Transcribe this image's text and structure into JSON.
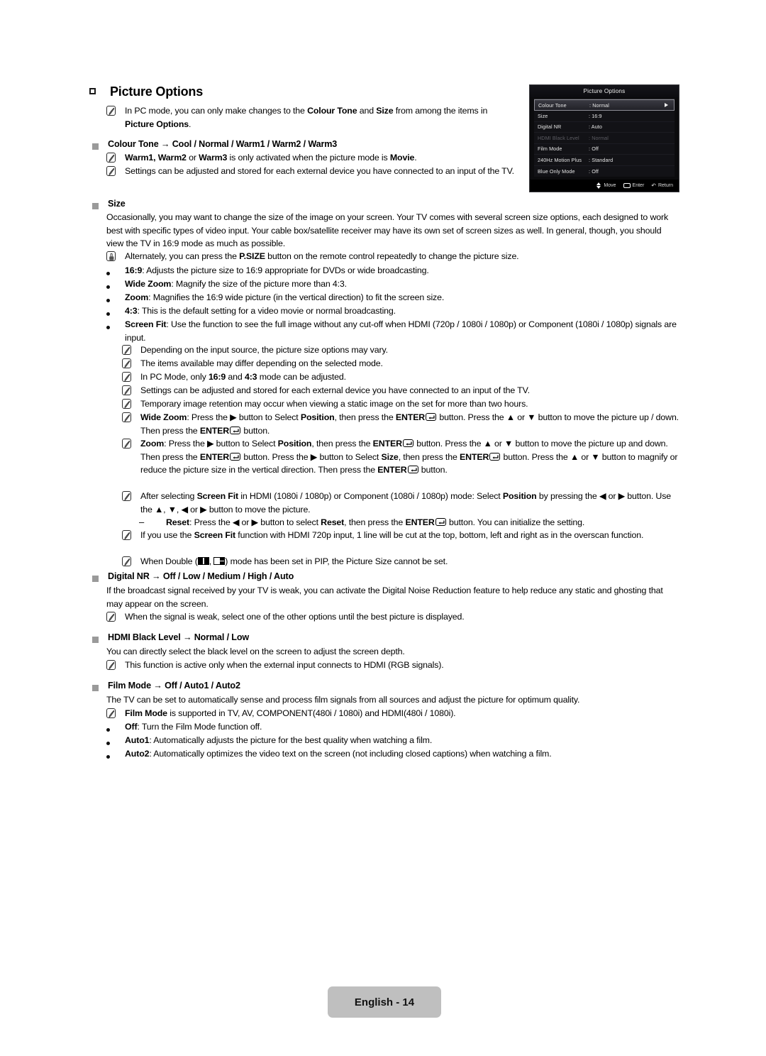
{
  "page": {
    "heading": "Picture Options",
    "footer_label": "English - 14"
  },
  "osd": {
    "title": "Picture Options",
    "rows": [
      {
        "label": "Colour Tone",
        "value": ": Normal",
        "selected": true,
        "disabled": false
      },
      {
        "label": "Size",
        "value": ": 16:9",
        "selected": false,
        "disabled": false
      },
      {
        "label": "Digital NR",
        "value": ": Auto",
        "selected": false,
        "disabled": false
      },
      {
        "label": "HDMI Black Level",
        "value": ": Normal",
        "selected": false,
        "disabled": true
      },
      {
        "label": "Film Mode",
        "value": ": Off",
        "selected": false,
        "disabled": false
      },
      {
        "label": "240Hz Motion Plus",
        "value": ": Standard",
        "selected": false,
        "disabled": false
      },
      {
        "label": "Blue Only Mode",
        "value": ": Off",
        "selected": false,
        "disabled": false
      }
    ],
    "footer": {
      "move": "Move",
      "enter": "Enter",
      "return": "Return"
    }
  },
  "intro_note": {
    "p1": "In PC mode, you can only make changes to the ",
    "b1": "Colour Tone",
    "p2": " and ",
    "b2": "Size",
    "p3": " from among the items in ",
    "b3": "Picture Options",
    "p4": "."
  },
  "colour_tone": {
    "heading_bold": "Colour Tone",
    "heading_rest": " → Cool / Normal / Warm1 / Warm2 / Warm3",
    "note1": {
      "b1": "Warm1, Warm2",
      "t1": " or ",
      "b2": "Warm3",
      "t2": " is only activated when the picture mode is ",
      "b3": "Movie",
      "t3": "."
    },
    "note2": "Settings can be adjusted and stored for each external device you have connected to an input of the TV."
  },
  "size": {
    "heading": "Size",
    "paragraph": "Occasionally, you may want to change the size of the image on your screen. Your TV comes with several screen size options, each designed to work best with specific types of video input. Your cable box/satellite receiver may have its own set of screen sizes as well. In general, though, you should view the TV in 16:9 mode as much as possible.",
    "hand_note": {
      "t1": "Alternately, you can press the ",
      "b1": "P.SIZE",
      "t2": " button on the remote control repeatedly to change the picture size."
    },
    "bullets": [
      {
        "bold": "16:9",
        "rest": ": Adjusts the picture size to 16:9 appropriate for DVDs or wide broadcasting."
      },
      {
        "bold": "Wide Zoom",
        "rest": ": Magnify the size of the picture more than 4:3."
      },
      {
        "bold": "Zoom",
        "rest": ": Magnifies the 16:9 wide picture (in the vertical direction) to fit the screen size."
      },
      {
        "bold": "4:3",
        "rest": ": This is the default setting for a video movie or normal broadcasting."
      },
      {
        "bold": "Screen Fit",
        "rest": ": Use the function to see the full image without any cut-off when HDMI (720p / 1080i / 1080p) or Component (1080i / 1080p) signals are input."
      }
    ],
    "notes": {
      "n1": "Depending on the input source, the picture size options may vary.",
      "n2": "The items available may differ depending on the selected mode.",
      "n3": {
        "t1": "In PC Mode, only ",
        "b1": "16:9",
        "t2": " and ",
        "b2": "4:3",
        "t3": " mode can be adjusted."
      },
      "n4": "Settings can be adjusted and stored for each external device you have connected to an input of the TV.",
      "n5": "Temporary image retention may occur when viewing a static image on the set for more than two hours.",
      "n6": {
        "b1": "Wide Zoom",
        "t1": ": Press the ▶ button to Select ",
        "b2": "Position",
        "t2": ", then press the ",
        "b3": "ENTER",
        "t3": " button. Press the ▲ or ▼ button to move the picture up / down. Then press the ",
        "b4": "ENTER",
        "t4": " button."
      },
      "n7": {
        "b1": "Zoom",
        "t1": ": Press the ▶ button to Select ",
        "b2": "Position",
        "t2": ", then press the ",
        "b3": "ENTER",
        "t3": " button. Press the ▲ or ▼ button to move the picture up and down. Then press the ",
        "b4": "ENTER",
        "t4": " button. Press the ▶ button to Select ",
        "b5": "Size",
        "t5": ", then press the ",
        "b6": "ENTER",
        "t6": " button. Press the ▲ or ▼ button to magnify or reduce the picture size in the vertical direction. Then press the ",
        "b7": "ENTER",
        "t7": " button."
      },
      "n8": {
        "t1": "After selecting ",
        "b1": "Screen Fit",
        "t2": " in HDMI (1080i / 1080p) or Component (1080i / 1080p) mode: Select ",
        "b2": "Position",
        "t3": " by pressing the ◀ or ▶ button. Use the ▲, ▼, ◀ or ▶ button to move the picture."
      },
      "reset": {
        "b1": "Reset",
        "t1": ": Press the ◀ or ▶ button to select ",
        "b2": "Reset",
        "t2": ", then press the ",
        "b3": "ENTER",
        "t3": " button. You can initialize the setting."
      },
      "n9": {
        "t1": "If you use the ",
        "b1": "Screen Fit",
        "t2": " function with HDMI 720p input, 1 line will be cut at the top, bottom, left and right as in the overscan function."
      },
      "n10": {
        "t1": "When Double (",
        "t2": ", ",
        "t3": ") mode has been set in PIP, the Picture Size cannot be set."
      }
    }
  },
  "digital_nr": {
    "heading_bold": "Digital NR",
    "heading_rest": " → Off / Low / Medium / High / Auto",
    "paragraph": "If the broadcast signal received by your TV is weak, you can activate the Digital Noise Reduction feature to help reduce any static and ghosting that may appear on the screen.",
    "note": "When the signal is weak, select one of the other options until the best picture is displayed."
  },
  "hdmi_black_level": {
    "heading_bold": "HDMI Black Level",
    "heading_rest": " → Normal / Low",
    "paragraph": "You can directly select the black level on the screen to adjust the screen depth.",
    "note": "This function is active only when the external input connects to HDMI (RGB signals)."
  },
  "film_mode": {
    "heading_bold": "Film Mode",
    "heading_rest": " → Off / Auto1 / Auto2",
    "paragraph": "The TV can be set to automatically sense and process film signals from all sources and adjust the picture for optimum quality.",
    "note": {
      "b1": "Film Mode",
      "t1": " is supported in TV, AV, COMPONENT(480i / 1080i) and HDMI(480i / 1080i)."
    },
    "bullets": [
      {
        "bold": "Off",
        "rest": ": Turn the Film Mode function off."
      },
      {
        "bold": "Auto1",
        "rest": ": Automatically adjusts the picture for the best quality when watching a film."
      },
      {
        "bold": "Auto2",
        "rest": ": Automatically optimizes the video text on the screen (not including closed captions) when watching a film."
      }
    ]
  }
}
